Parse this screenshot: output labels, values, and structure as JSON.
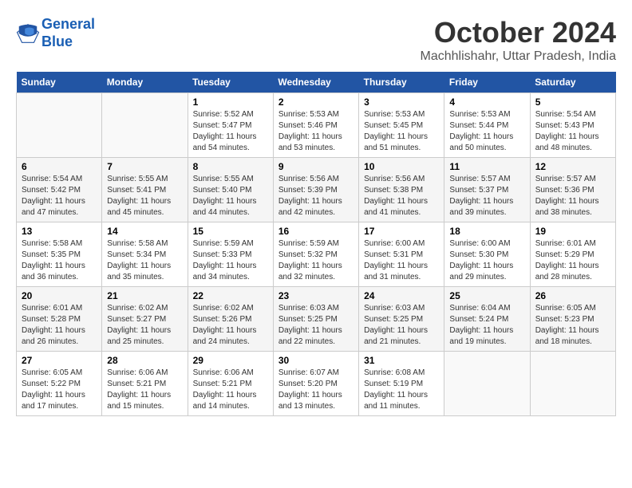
{
  "header": {
    "logo_line1": "General",
    "logo_line2": "Blue",
    "month": "October 2024",
    "location": "Machhlishahr, Uttar Pradesh, India"
  },
  "weekdays": [
    "Sunday",
    "Monday",
    "Tuesday",
    "Wednesday",
    "Thursday",
    "Friday",
    "Saturday"
  ],
  "weeks": [
    [
      {
        "day": "",
        "info": ""
      },
      {
        "day": "",
        "info": ""
      },
      {
        "day": "1",
        "info": "Sunrise: 5:52 AM\nSunset: 5:47 PM\nDaylight: 11 hours and 54 minutes."
      },
      {
        "day": "2",
        "info": "Sunrise: 5:53 AM\nSunset: 5:46 PM\nDaylight: 11 hours and 53 minutes."
      },
      {
        "day": "3",
        "info": "Sunrise: 5:53 AM\nSunset: 5:45 PM\nDaylight: 11 hours and 51 minutes."
      },
      {
        "day": "4",
        "info": "Sunrise: 5:53 AM\nSunset: 5:44 PM\nDaylight: 11 hours and 50 minutes."
      },
      {
        "day": "5",
        "info": "Sunrise: 5:54 AM\nSunset: 5:43 PM\nDaylight: 11 hours and 48 minutes."
      }
    ],
    [
      {
        "day": "6",
        "info": "Sunrise: 5:54 AM\nSunset: 5:42 PM\nDaylight: 11 hours and 47 minutes."
      },
      {
        "day": "7",
        "info": "Sunrise: 5:55 AM\nSunset: 5:41 PM\nDaylight: 11 hours and 45 minutes."
      },
      {
        "day": "8",
        "info": "Sunrise: 5:55 AM\nSunset: 5:40 PM\nDaylight: 11 hours and 44 minutes."
      },
      {
        "day": "9",
        "info": "Sunrise: 5:56 AM\nSunset: 5:39 PM\nDaylight: 11 hours and 42 minutes."
      },
      {
        "day": "10",
        "info": "Sunrise: 5:56 AM\nSunset: 5:38 PM\nDaylight: 11 hours and 41 minutes."
      },
      {
        "day": "11",
        "info": "Sunrise: 5:57 AM\nSunset: 5:37 PM\nDaylight: 11 hours and 39 minutes."
      },
      {
        "day": "12",
        "info": "Sunrise: 5:57 AM\nSunset: 5:36 PM\nDaylight: 11 hours and 38 minutes."
      }
    ],
    [
      {
        "day": "13",
        "info": "Sunrise: 5:58 AM\nSunset: 5:35 PM\nDaylight: 11 hours and 36 minutes."
      },
      {
        "day": "14",
        "info": "Sunrise: 5:58 AM\nSunset: 5:34 PM\nDaylight: 11 hours and 35 minutes."
      },
      {
        "day": "15",
        "info": "Sunrise: 5:59 AM\nSunset: 5:33 PM\nDaylight: 11 hours and 34 minutes."
      },
      {
        "day": "16",
        "info": "Sunrise: 5:59 AM\nSunset: 5:32 PM\nDaylight: 11 hours and 32 minutes."
      },
      {
        "day": "17",
        "info": "Sunrise: 6:00 AM\nSunset: 5:31 PM\nDaylight: 11 hours and 31 minutes."
      },
      {
        "day": "18",
        "info": "Sunrise: 6:00 AM\nSunset: 5:30 PM\nDaylight: 11 hours and 29 minutes."
      },
      {
        "day": "19",
        "info": "Sunrise: 6:01 AM\nSunset: 5:29 PM\nDaylight: 11 hours and 28 minutes."
      }
    ],
    [
      {
        "day": "20",
        "info": "Sunrise: 6:01 AM\nSunset: 5:28 PM\nDaylight: 11 hours and 26 minutes."
      },
      {
        "day": "21",
        "info": "Sunrise: 6:02 AM\nSunset: 5:27 PM\nDaylight: 11 hours and 25 minutes."
      },
      {
        "day": "22",
        "info": "Sunrise: 6:02 AM\nSunset: 5:26 PM\nDaylight: 11 hours and 24 minutes."
      },
      {
        "day": "23",
        "info": "Sunrise: 6:03 AM\nSunset: 5:25 PM\nDaylight: 11 hours and 22 minutes."
      },
      {
        "day": "24",
        "info": "Sunrise: 6:03 AM\nSunset: 5:25 PM\nDaylight: 11 hours and 21 minutes."
      },
      {
        "day": "25",
        "info": "Sunrise: 6:04 AM\nSunset: 5:24 PM\nDaylight: 11 hours and 19 minutes."
      },
      {
        "day": "26",
        "info": "Sunrise: 6:05 AM\nSunset: 5:23 PM\nDaylight: 11 hours and 18 minutes."
      }
    ],
    [
      {
        "day": "27",
        "info": "Sunrise: 6:05 AM\nSunset: 5:22 PM\nDaylight: 11 hours and 17 minutes."
      },
      {
        "day": "28",
        "info": "Sunrise: 6:06 AM\nSunset: 5:21 PM\nDaylight: 11 hours and 15 minutes."
      },
      {
        "day": "29",
        "info": "Sunrise: 6:06 AM\nSunset: 5:21 PM\nDaylight: 11 hours and 14 minutes."
      },
      {
        "day": "30",
        "info": "Sunrise: 6:07 AM\nSunset: 5:20 PM\nDaylight: 11 hours and 13 minutes."
      },
      {
        "day": "31",
        "info": "Sunrise: 6:08 AM\nSunset: 5:19 PM\nDaylight: 11 hours and 11 minutes."
      },
      {
        "day": "",
        "info": ""
      },
      {
        "day": "",
        "info": ""
      }
    ]
  ]
}
